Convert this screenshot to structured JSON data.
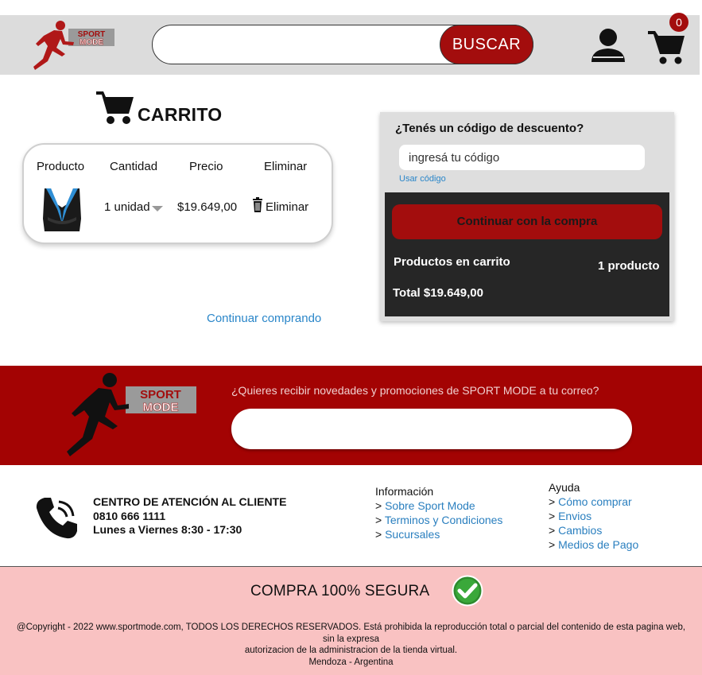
{
  "header": {
    "logo_text_top": "SPORT",
    "logo_text_bottom": "MODE",
    "search_placeholder": "",
    "search_button": "BUSCAR",
    "cart_count": "0"
  },
  "cart": {
    "title": "CARRITO",
    "columns": [
      "Producto",
      "Cantidad",
      "Precio",
      "Eliminar"
    ],
    "items": [
      {
        "quantity": "1 unidad",
        "price": "$19.649,00",
        "delete_label": "Eliminar"
      }
    ],
    "continue_shopping": "Continuar comprando"
  },
  "discount": {
    "question": "¿Tenés un código de descuento?",
    "input_value": "ingresá tu código",
    "use_code": "Usar código",
    "checkout_button": "Continuar con la compra",
    "items_label": "Productos en carrito",
    "items_count": "1 producto",
    "total": "Total $19.649,00"
  },
  "newsletter": {
    "prompt": "¿Quieres recibir novedades y promociones de SPORT MODE a tu correo?",
    "input_value": ""
  },
  "support": {
    "title": "CENTRO DE ATENCIÓN AL CLIENTE",
    "phone": "0810 666 1111",
    "hours": "Lunes a Viernes 8:30 - 17:30"
  },
  "info": {
    "heading": "Información",
    "links": [
      "Sobre Sport Mode",
      "Terminos y Condiciones",
      "Sucursales"
    ]
  },
  "help": {
    "heading": "Ayuda",
    "links": [
      "Cómo comprar",
      "Envios",
      "Cambios",
      "Medios de Pago"
    ]
  },
  "footer": {
    "secure": "COMPRA 100% SEGURA",
    "copyright_line1": "@Copyright - 2022 www.sportmode.com, TODOS LOS DERECHOS RESERVADOS. Está prohibida la reproducción total o parcial del contenido de esta pagina web, sin la expresa",
    "copyright_line2": "autorizacion de la administracion de la tienda virtual.",
    "copyright_line3": "Mendoza - Argentina"
  },
  "colors": {
    "brand_red": "#a30d0d",
    "header_gray": "#dcdcdc",
    "link_blue": "#2a86c9",
    "footer_pink": "#f9c2c2"
  }
}
